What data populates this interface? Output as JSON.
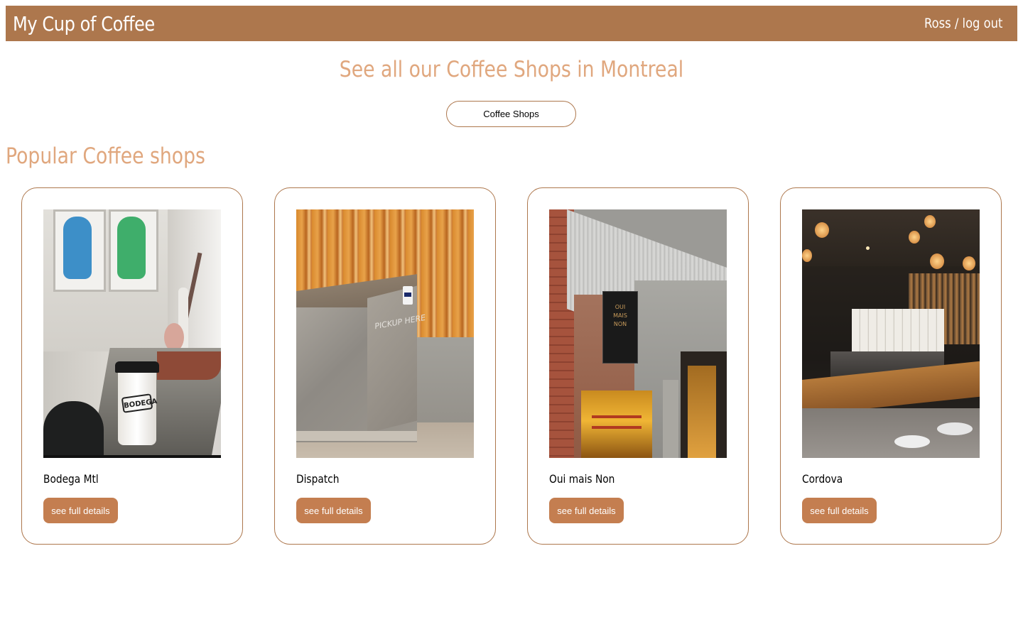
{
  "navbar": {
    "brand": "My Cup of Coffee",
    "user": "Ross",
    "separator": " / ",
    "logout": "log out"
  },
  "hero": {
    "title": "See all our Coffee Shops in Montreal",
    "button_label": "Coffee Shops"
  },
  "popular": {
    "title": "Popular Coffee shops",
    "details_label": "see full details",
    "shops": [
      {
        "name": "Bodega Mtl",
        "photo_text": "BODEGA"
      },
      {
        "name": "Dispatch",
        "photo_text": "PICKUP HERE"
      },
      {
        "name": "Oui mais Non",
        "photo_text": "OUI MAIS NON"
      },
      {
        "name": "Cordova"
      }
    ]
  },
  "colors": {
    "brand": "#ad774d",
    "accent_text": "#e0a77e",
    "button": "#c47e50"
  }
}
